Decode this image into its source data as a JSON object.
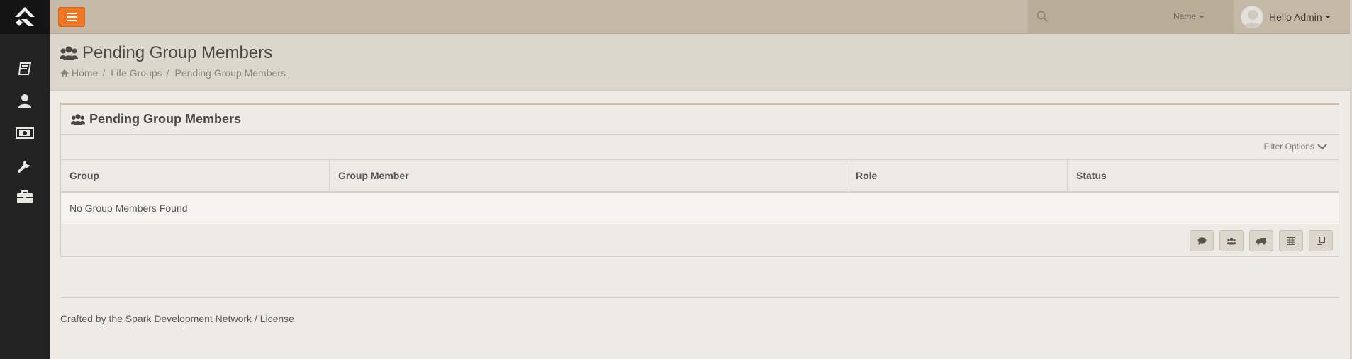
{
  "topbar": {
    "search_placeholder": "",
    "search_type_label": "Name",
    "user_greeting": "Hello Admin"
  },
  "sidebar": {
    "items": [
      {
        "icon": "book-icon"
      },
      {
        "icon": "user-icon"
      },
      {
        "icon": "money-icon"
      },
      {
        "icon": "wrench-icon"
      },
      {
        "icon": "briefcase-icon"
      }
    ]
  },
  "page": {
    "title": "Pending Group Members",
    "breadcrumb": [
      "Home",
      "Life Groups",
      "Pending Group Members"
    ]
  },
  "panel": {
    "title": "Pending Group Members",
    "filter_label": "Filter Options",
    "columns": [
      "Group",
      "Group Member",
      "Role",
      "Status"
    ],
    "empty_message": "No Group Members Found",
    "actions": [
      "communicate-icon",
      "merge-group-icon",
      "launch-workflow-icon",
      "export-excel-icon",
      "merge-template-icon"
    ]
  },
  "footer": {
    "prefix": "Crafted by the ",
    "org": "Spark Development Network",
    "sep": " / ",
    "license": "License"
  },
  "colors": {
    "accent": "#ee7624",
    "sidebar_bg": "#242323",
    "topbar_bg": "#c3b9a6"
  }
}
